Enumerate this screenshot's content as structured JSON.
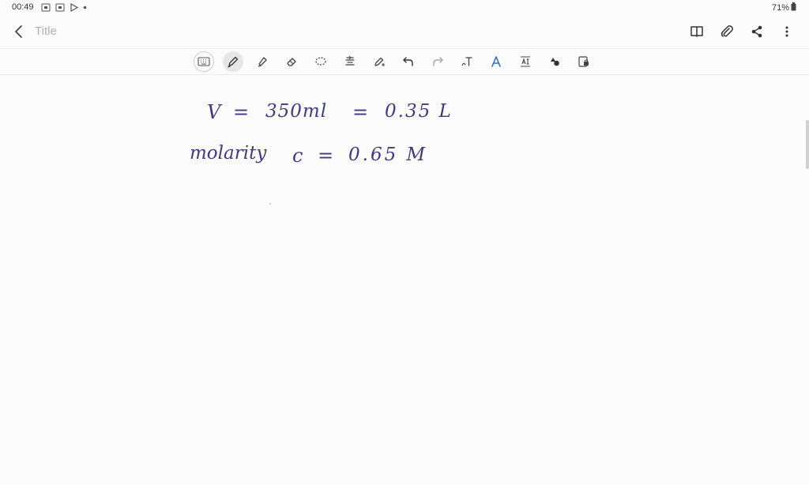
{
  "status": {
    "time": "00:49",
    "battery": "71%",
    "icons": [
      "screenshot-icon",
      "screenshot-icon",
      "play-store-icon",
      "dot-icon"
    ]
  },
  "header": {
    "title_placeholder": "Title",
    "actions": [
      "book-view-icon",
      "attach-icon",
      "share-icon",
      "more-vert-icon"
    ]
  },
  "toolbar": {
    "tools": [
      "keyboard",
      "pen",
      "highlighter",
      "eraser",
      "lasso",
      "text-align",
      "pen-settings",
      "undo",
      "redo",
      "text-tool",
      "text-style",
      "insert-text",
      "shapes",
      "lock"
    ],
    "active_tool": "pen"
  },
  "canvas": {
    "line1": {
      "lhs": "V",
      "eq1": "=",
      "volume_ml": "350ml",
      "eq2": "=",
      "volume_l": "0.35 L"
    },
    "line2": {
      "label": "molarity",
      "symbol": "c",
      "eq": "=",
      "value": "0.65 M"
    }
  },
  "colors": {
    "ink": "#3c3a86",
    "toolbar_accent": "#2f6fd6"
  }
}
